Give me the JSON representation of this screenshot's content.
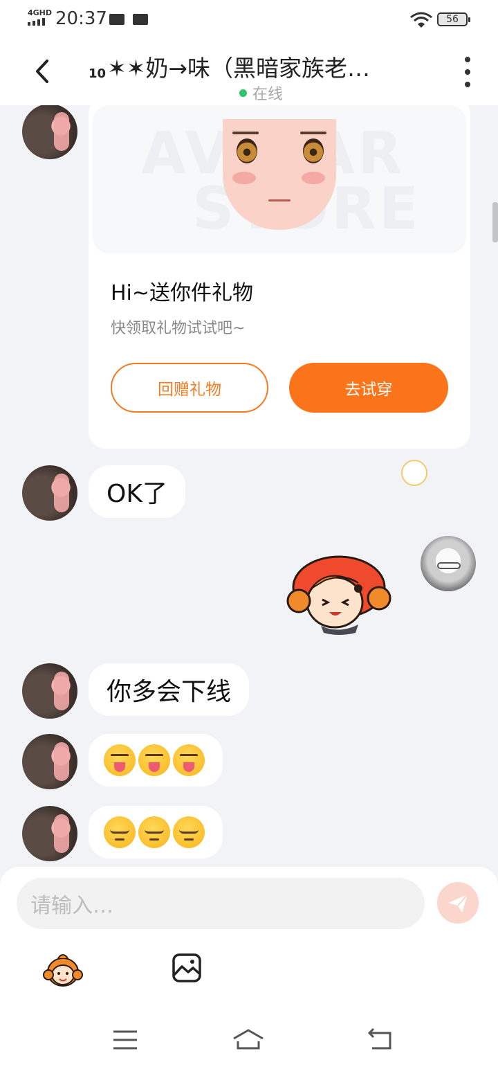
{
  "status_bar": {
    "network": "4GHD",
    "time": "20:37",
    "battery": "56"
  },
  "header": {
    "title_level": "10",
    "title": "✶✶奶→味（黑暗家族老…",
    "status": "在线"
  },
  "gift_card": {
    "watermark_line1": "AVATAR",
    "watermark_line2": "STORE",
    "title": "Hi~送你件礼物",
    "subtitle": "快领取礼物试试吧~",
    "return_gift_label": "回赠礼物",
    "try_on_label": "去试穿"
  },
  "messages": [
    {
      "sender": "other",
      "text": "OK了"
    },
    {
      "sender": "self",
      "type": "sticker"
    },
    {
      "sender": "other",
      "text": "你多会下线"
    },
    {
      "sender": "other",
      "type": "emoji",
      "emoji": "squinting-face-with-tongue",
      "count": 3
    },
    {
      "sender": "other",
      "type": "emoji",
      "emoji": "pensive-face",
      "count": 3
    }
  ],
  "input": {
    "placeholder": "请输入…"
  },
  "colors": {
    "accent_orange": "#fb7419",
    "online_green": "#2cc36b",
    "chat_background": "#f2f3f7"
  },
  "icons": {
    "back": "back-arrow-icon",
    "more": "more-vertical-icon",
    "send": "send-icon",
    "mascot": "mascot-emoji-icon",
    "image": "image-icon",
    "nav_menu": "menu-icon",
    "nav_home": "home-icon",
    "nav_back": "return-icon"
  }
}
